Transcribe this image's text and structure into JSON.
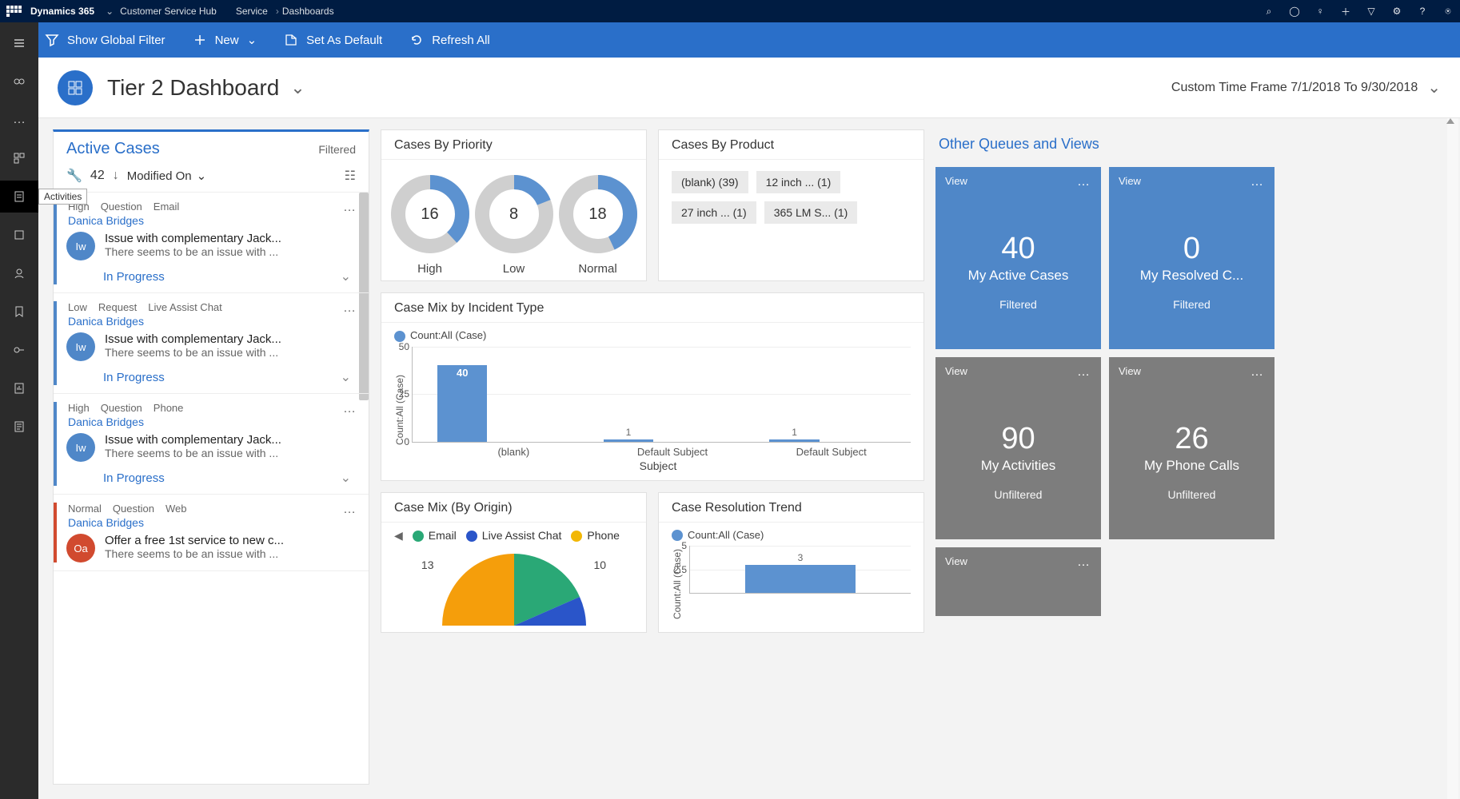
{
  "topbar": {
    "brand": "Dynamics 365",
    "app": "Customer Service Hub",
    "crumbs": [
      "Service",
      "Dashboards"
    ]
  },
  "cmdbar": {
    "global_filter": "Show Global Filter",
    "new": "New",
    "set_default": "Set As Default",
    "refresh": "Refresh All"
  },
  "rail_tooltip": "Activities",
  "title": {
    "text": "Tier 2 Dashboard",
    "timeframe": "Custom Time Frame 7/1/2018 To 9/30/2018"
  },
  "active_cases": {
    "header": "Active Cases",
    "filtered": "Filtered",
    "count": "42",
    "sort": "Modified On",
    "items": [
      {
        "priority": "High",
        "type": "Question",
        "channel": "Email",
        "owner": "Danica Bridges",
        "avatar": "Iw",
        "avc": "#4f87c8",
        "bar": "#4f87c8",
        "title": "Issue with complementary Jack...",
        "desc": "There seems to be an issue with ...",
        "status": "In Progress"
      },
      {
        "priority": "Low",
        "type": "Request",
        "channel": "Live Assist Chat",
        "owner": "Danica Bridges",
        "avatar": "Iw",
        "avc": "#4f87c8",
        "bar": "#4f87c8",
        "title": "Issue with complementary Jack...",
        "desc": "There seems to be an issue with ...",
        "status": "In Progress"
      },
      {
        "priority": "High",
        "type": "Question",
        "channel": "Phone",
        "owner": "Danica Bridges",
        "avatar": "Iw",
        "avc": "#4f87c8",
        "bar": "#4f87c8",
        "title": "Issue with complementary Jack...",
        "desc": "There seems to be an issue with ...",
        "status": "In Progress"
      },
      {
        "priority": "Normal",
        "type": "Question",
        "channel": "Web",
        "owner": "Danica Bridges",
        "avatar": "Oa",
        "avc": "#d14a2f",
        "bar": "#d14a2f",
        "title": "Offer a free 1st service to new c...",
        "desc": "There seems to be an issue with ...",
        "status": ""
      }
    ]
  },
  "priority": {
    "header": "Cases By Priority",
    "items": [
      {
        "label": "High",
        "value": 16,
        "pct": 38
      },
      {
        "label": "Low",
        "value": 8,
        "pct": 19
      },
      {
        "label": "Normal",
        "value": 18,
        "pct": 43
      }
    ]
  },
  "product": {
    "header": "Cases By Product",
    "chips": [
      "(blank) (39)",
      "12 inch ... (1)",
      "27 inch ... (1)",
      "365 LM S... (1)"
    ]
  },
  "incident": {
    "header": "Case Mix by Incident Type",
    "legend": "Count:All (Case)",
    "ylabel": "Count:All (Case)",
    "xlabel": "Subject",
    "yticks": [
      "50",
      "25",
      "0"
    ],
    "bars": [
      {
        "label": "(blank)",
        "value": 40,
        "inside": true
      },
      {
        "label": "Default Subject",
        "value": 1,
        "inside": false
      },
      {
        "label": "Default Subject",
        "value": 1,
        "inside": false
      }
    ]
  },
  "origin": {
    "header": "Case Mix (By Origin)",
    "legend": [
      {
        "label": "Email",
        "color": "#2aa876"
      },
      {
        "label": "Live Assist Chat",
        "color": "#2a55c9"
      },
      {
        "label": "Phone",
        "color": "#f2b705"
      }
    ],
    "left_label": "13",
    "right_label": "10"
  },
  "resolution": {
    "header": "Case Resolution Trend",
    "legend": "Count:All (Case)",
    "ylabel": "Count:All (Case)",
    "yticks": [
      "5",
      "2.5"
    ],
    "bars": [
      {
        "value": 3
      }
    ]
  },
  "queues": {
    "header": "Other Queues and Views",
    "view_label": "View",
    "tiles": [
      {
        "value": "40",
        "name": "My Active Cases",
        "filter": "Filtered",
        "color": "blue"
      },
      {
        "value": "0",
        "name": "My Resolved C...",
        "filter": "Filtered",
        "color": "blue"
      },
      {
        "value": "90",
        "name": "My Activities",
        "filter": "Unfiltered",
        "color": "gray"
      },
      {
        "value": "26",
        "name": "My Phone Calls",
        "filter": "Unfiltered",
        "color": "gray"
      }
    ]
  },
  "chart_data": [
    {
      "type": "pie",
      "title": "Cases By Priority",
      "series": [
        {
          "name": "High",
          "values": [
            16
          ]
        },
        {
          "name": "Low",
          "values": [
            8
          ]
        },
        {
          "name": "Normal",
          "values": [
            18
          ]
        }
      ]
    },
    {
      "type": "bar",
      "title": "Case Mix by Incident Type",
      "xlabel": "Subject",
      "ylabel": "Count:All (Case)",
      "categories": [
        "(blank)",
        "Default Subject",
        "Default Subject"
      ],
      "values": [
        40,
        1,
        1
      ],
      "ylim": [
        0,
        50
      ]
    },
    {
      "type": "pie",
      "title": "Case Mix (By Origin)",
      "series": [
        {
          "name": "Email",
          "values": [
            13
          ]
        },
        {
          "name": "Live Assist Chat",
          "values": [
            3
          ]
        },
        {
          "name": "Phone",
          "values": [
            10
          ]
        }
      ]
    },
    {
      "type": "bar",
      "title": "Case Resolution Trend",
      "ylabel": "Count:All (Case)",
      "categories": [
        ""
      ],
      "values": [
        3
      ],
      "ylim": [
        0,
        5
      ]
    }
  ]
}
